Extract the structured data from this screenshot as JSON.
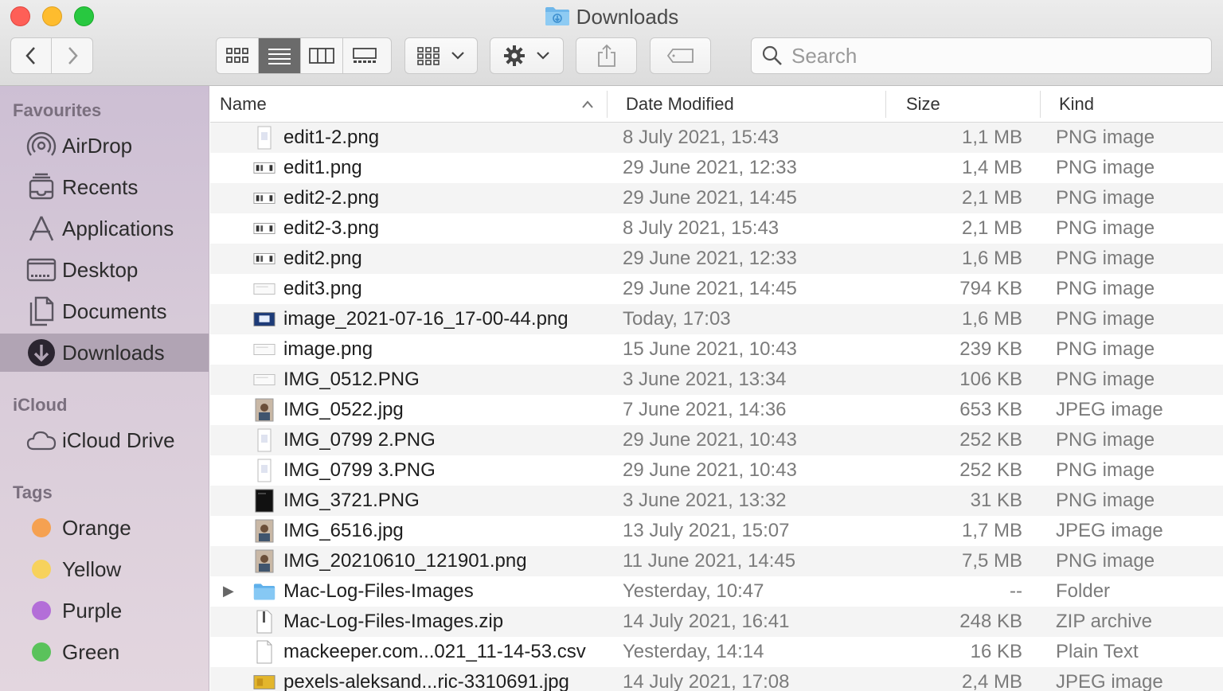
{
  "window": {
    "title": "Downloads"
  },
  "toolbar": {
    "back_icon": "chevron-left-icon",
    "forward_icon": "chevron-right-icon",
    "views": [
      "icon-view",
      "list-view",
      "column-view",
      "gallery-view"
    ],
    "active_view": "list-view",
    "search_placeholder": "Search"
  },
  "sidebar": {
    "favourites_header": "Favourites",
    "favourites": [
      {
        "label": "AirDrop",
        "icon": "airdrop-icon"
      },
      {
        "label": "Recents",
        "icon": "recents-icon"
      },
      {
        "label": "Applications",
        "icon": "applications-icon"
      },
      {
        "label": "Desktop",
        "icon": "desktop-icon"
      },
      {
        "label": "Documents",
        "icon": "documents-icon"
      },
      {
        "label": "Downloads",
        "icon": "downloads-icon",
        "selected": true
      }
    ],
    "icloud_header": "iCloud",
    "icloud": [
      {
        "label": "iCloud Drive",
        "icon": "cloud-icon"
      }
    ],
    "tags_header": "Tags",
    "tags": [
      {
        "label": "Orange",
        "color": "#f5a151"
      },
      {
        "label": "Yellow",
        "color": "#f7d25c"
      },
      {
        "label": "Purple",
        "color": "#b36ed8"
      },
      {
        "label": "Green",
        "color": "#5ac25b"
      }
    ]
  },
  "columns": {
    "name": "Name",
    "date": "Date Modified",
    "size": "Size",
    "kind": "Kind"
  },
  "files": [
    {
      "name": "edit1-2.png",
      "date": "8 July 2021, 15:43",
      "size": "1,1 MB",
      "kind": "PNG image",
      "thumb": "portrait"
    },
    {
      "name": "edit1.png",
      "date": "29 June 2021, 12:33",
      "size": "1,4 MB",
      "kind": "PNG image",
      "thumb": "wide"
    },
    {
      "name": "edit2-2.png",
      "date": "29 June 2021, 14:45",
      "size": "2,1 MB",
      "kind": "PNG image",
      "thumb": "wide"
    },
    {
      "name": "edit2-3.png",
      "date": "8 July 2021, 15:43",
      "size": "2,1 MB",
      "kind": "PNG image",
      "thumb": "wide"
    },
    {
      "name": "edit2.png",
      "date": "29 June 2021, 12:33",
      "size": "1,6 MB",
      "kind": "PNG image",
      "thumb": "wide"
    },
    {
      "name": "edit3.png",
      "date": "29 June 2021, 14:45",
      "size": "794 KB",
      "kind": "PNG image",
      "thumb": "light"
    },
    {
      "name": "image_2021-07-16_17-00-44.png",
      "date": "Today, 17:03",
      "size": "1,6 MB",
      "kind": "PNG image",
      "thumb": "blue"
    },
    {
      "name": "image.png",
      "date": "15 June 2021, 10:43",
      "size": "239 KB",
      "kind": "PNG image",
      "thumb": "light"
    },
    {
      "name": "IMG_0512.PNG",
      "date": "3 June 2021, 13:34",
      "size": "106 KB",
      "kind": "PNG image",
      "thumb": "light"
    },
    {
      "name": "IMG_0522.jpg",
      "date": "7 June 2021, 14:36",
      "size": "653 KB",
      "kind": "JPEG image",
      "thumb": "photo"
    },
    {
      "name": "IMG_0799 2.PNG",
      "date": "29 June 2021, 10:43",
      "size": "252 KB",
      "kind": "PNG image",
      "thumb": "portrait"
    },
    {
      "name": "IMG_0799 3.PNG",
      "date": "29 June 2021, 10:43",
      "size": "252 KB",
      "kind": "PNG image",
      "thumb": "portrait"
    },
    {
      "name": "IMG_3721.PNG",
      "date": "3 June 2021, 13:32",
      "size": "31 KB",
      "kind": "PNG image",
      "thumb": "dark"
    },
    {
      "name": "IMG_6516.jpg",
      "date": "13 July 2021, 15:07",
      "size": "1,7 MB",
      "kind": "JPEG image",
      "thumb": "photo"
    },
    {
      "name": "IMG_20210610_121901.png",
      "date": "11 June 2021, 14:45",
      "size": "7,5 MB",
      "kind": "PNG image",
      "thumb": "photo"
    },
    {
      "name": "Mac-Log-Files-Images",
      "date": "Yesterday, 10:47",
      "size": "--",
      "kind": "Folder",
      "thumb": "folder"
    },
    {
      "name": "Mac-Log-Files-Images.zip",
      "date": "14 July 2021, 16:41",
      "size": "248 KB",
      "kind": "ZIP archive",
      "thumb": "zip"
    },
    {
      "name": "mackeeper.com...021_11-14-53.csv",
      "date": "Yesterday, 14:14",
      "size": "16 KB",
      "kind": "Plain Text",
      "thumb": "doc"
    },
    {
      "name": "pexels-aleksand...ric-3310691.jpg",
      "date": "14 July 2021, 17:08",
      "size": "2,4 MB",
      "kind": "JPEG image",
      "thumb": "yellow"
    }
  ]
}
